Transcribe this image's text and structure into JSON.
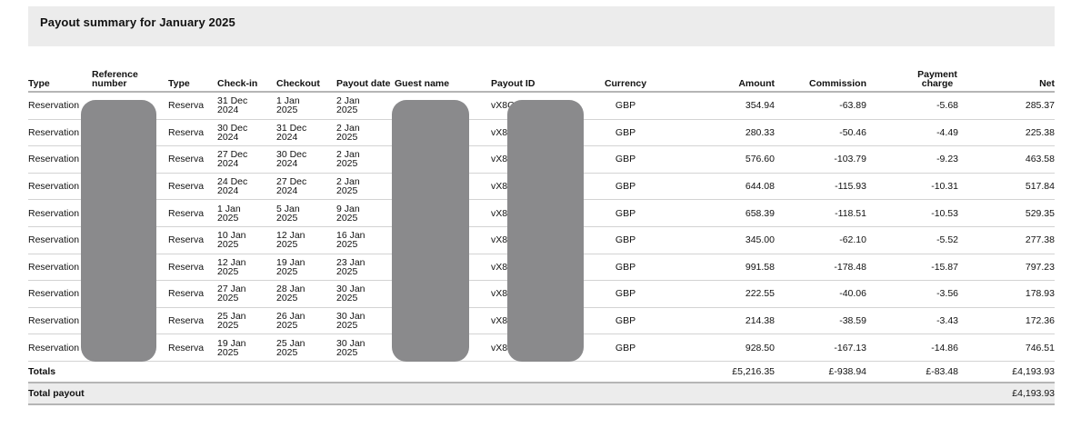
{
  "title": "Payout summary for January 2025",
  "headers": [
    "Type",
    "Reference number",
    "Type",
    "Check-in",
    "Checkout",
    "Payout date",
    "Guest name",
    "Payout ID",
    "Currency",
    "Amount",
    "Commission",
    "Payment charge",
    "Net"
  ],
  "rows": [
    {
      "type": "Reservation",
      "ref": "",
      "type2": "Reserva",
      "checkin": "31 Dec 2024",
      "checkout": "1 Jan 2025",
      "payout_date": "2 Jan 2025",
      "guest": "",
      "payout_id": "vX8C",
      "currency": "GBP",
      "amount": "354.94",
      "commission": "-63.89",
      "charge": "-5.68",
      "net": "285.37"
    },
    {
      "type": "Reservation",
      "ref": "",
      "type2": "Reserva",
      "checkin": "30 Dec 2024",
      "checkout": "31 Dec 2024",
      "payout_date": "2 Jan 2025",
      "guest": "",
      "payout_id": "vX8",
      "currency": "GBP",
      "amount": "280.33",
      "commission": "-50.46",
      "charge": "-4.49",
      "net": "225.38"
    },
    {
      "type": "Reservation",
      "ref": "",
      "type2": "Reserva",
      "checkin": "27 Dec 2024",
      "checkout": "30 Dec 2024",
      "payout_date": "2 Jan 2025",
      "guest": "",
      "payout_id": "vX8",
      "currency": "GBP",
      "amount": "576.60",
      "commission": "-103.79",
      "charge": "-9.23",
      "net": "463.58"
    },
    {
      "type": "Reservation",
      "ref": "",
      "type2": "Reserva",
      "checkin": "24 Dec 2024",
      "checkout": "27 Dec 2024",
      "payout_date": "2 Jan 2025",
      "guest": "",
      "payout_id": "vX8",
      "currency": "GBP",
      "amount": "644.08",
      "commission": "-115.93",
      "charge": "-10.31",
      "net": "517.84"
    },
    {
      "type": "Reservation",
      "ref": "",
      "type2": "Reserva",
      "checkin": "1 Jan 2025",
      "checkout": "5 Jan 2025",
      "payout_date": "9 Jan 2025",
      "guest": "",
      "payout_id": "vX8",
      "currency": "GBP",
      "amount": "658.39",
      "commission": "-118.51",
      "charge": "-10.53",
      "net": "529.35"
    },
    {
      "type": "Reservation",
      "ref": "",
      "type2": "Reserva",
      "checkin": "10 Jan 2025",
      "checkout": "12 Jan 2025",
      "payout_date": "16 Jan 2025",
      "guest": "",
      "payout_id": "vX8",
      "currency": "GBP",
      "amount": "345.00",
      "commission": "-62.10",
      "charge": "-5.52",
      "net": "277.38"
    },
    {
      "type": "Reservation",
      "ref": "",
      "type2": "Reserva",
      "checkin": "12 Jan 2025",
      "checkout": "19 Jan 2025",
      "payout_date": "23 Jan 2025",
      "guest": "",
      "payout_id": "vX8",
      "currency": "GBP",
      "amount": "991.58",
      "commission": "-178.48",
      "charge": "-15.87",
      "net": "797.23"
    },
    {
      "type": "Reservation",
      "ref": "",
      "type2": "Reserva",
      "checkin": "27 Jan 2025",
      "checkout": "28 Jan 2025",
      "payout_date": "30 Jan 2025",
      "guest": "",
      "payout_id": "vX8",
      "currency": "GBP",
      "amount": "222.55",
      "commission": "-40.06",
      "charge": "-3.56",
      "net": "178.93"
    },
    {
      "type": "Reservation",
      "ref": "",
      "type2": "Reserva",
      "checkin": "25 Jan 2025",
      "checkout": "26 Jan 2025",
      "payout_date": "30 Jan 2025",
      "guest": "",
      "payout_id": "vX8",
      "currency": "GBP",
      "amount": "214.38",
      "commission": "-38.59",
      "charge": "-3.43",
      "net": "172.36"
    },
    {
      "type": "Reservation",
      "ref": "",
      "type2": "Reserva",
      "checkin": "19 Jan 2025",
      "checkout": "25 Jan 2025",
      "payout_date": "30 Jan 2025",
      "guest": "",
      "payout_id": "vX8C",
      "currency": "GBP",
      "amount": "928.50",
      "commission": "-167.13",
      "charge": "-14.86",
      "net": "746.51"
    }
  ],
  "totals": {
    "label": "Totals",
    "amount": "£5,216.35",
    "commission": "£-938.94",
    "charge": "£-83.48",
    "net": "£4,193.93"
  },
  "total_payout": {
    "label": "Total payout",
    "net": "£4,193.93"
  },
  "colors": {
    "redaction": "#8a8a8c",
    "band": "#ececec"
  }
}
